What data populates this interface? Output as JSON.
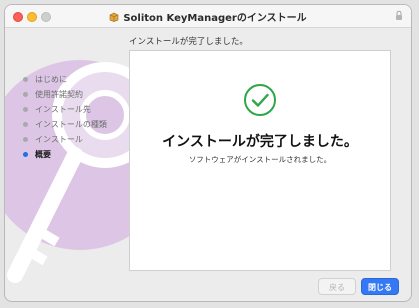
{
  "window": {
    "title": "Soliton KeyManagerのインストール",
    "title_icon": "installer-package-icon",
    "lock_icon": "lock-icon"
  },
  "subtitle": "インストールが完了しました。",
  "sidebar": {
    "steps": [
      {
        "label": "はじめに",
        "current": false
      },
      {
        "label": "使用許諾契約",
        "current": false
      },
      {
        "label": "インストール先",
        "current": false
      },
      {
        "label": "インストールの種類",
        "current": false
      },
      {
        "label": "インストール",
        "current": false
      },
      {
        "label": "概要",
        "current": true
      }
    ]
  },
  "content": {
    "icon": "checkmark-circle-icon",
    "headline": "インストールが完了しました。",
    "message": "ソフトウェアがインストールされました。"
  },
  "buttons": {
    "back_label": "戻る",
    "close_label": "閉じる"
  },
  "colors": {
    "accent": "#3478f6",
    "success": "#2ea64a"
  }
}
